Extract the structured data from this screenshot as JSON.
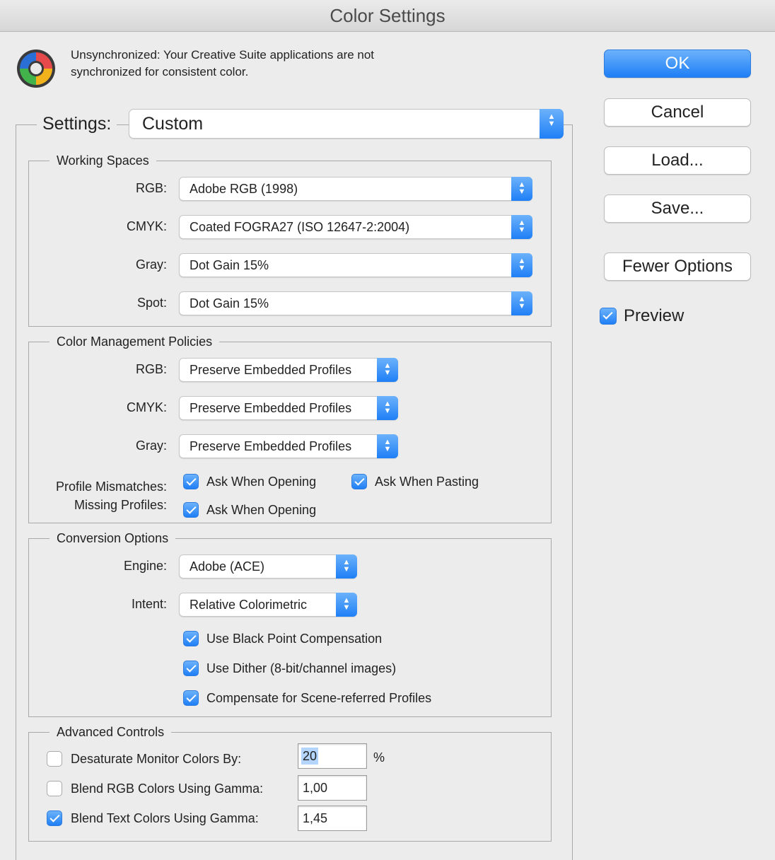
{
  "window": {
    "title": "Color Settings"
  },
  "sync_message": {
    "line1": "Unsynchronized: Your Creative Suite applications are not",
    "line2": "synchronized for consistent color."
  },
  "buttons": {
    "ok": "OK",
    "cancel": "Cancel",
    "load": "Load...",
    "save": "Save...",
    "fewer_options": "Fewer Options"
  },
  "preview": {
    "label": "Preview",
    "checked": true
  },
  "settings": {
    "label": "Settings:",
    "value": "Custom"
  },
  "working_spaces": {
    "title": "Working Spaces",
    "rgb": {
      "label": "RGB:",
      "value": "Adobe RGB (1998)"
    },
    "cmyk": {
      "label": "CMYK:",
      "value": "Coated FOGRA27 (ISO 12647-2:2004)"
    },
    "gray": {
      "label": "Gray:",
      "value": "Dot Gain 15%"
    },
    "spot": {
      "label": "Spot:",
      "value": "Dot Gain 15%"
    }
  },
  "policies": {
    "title": "Color Management Policies",
    "rgb": {
      "label": "RGB:",
      "value": "Preserve Embedded Profiles"
    },
    "cmyk": {
      "label": "CMYK:",
      "value": "Preserve Embedded Profiles"
    },
    "gray": {
      "label": "Gray:",
      "value": "Preserve Embedded Profiles"
    },
    "profile_mismatches": {
      "label": "Profile Mismatches:",
      "ask_opening": "Ask When Opening",
      "ask_pasting": "Ask When Pasting"
    },
    "missing_profiles": {
      "label": "Missing Profiles:",
      "ask_opening": "Ask When Opening"
    }
  },
  "conversion": {
    "title": "Conversion Options",
    "engine": {
      "label": "Engine:",
      "value": "Adobe (ACE)"
    },
    "intent": {
      "label": "Intent:",
      "value": "Relative Colorimetric"
    },
    "black_point": "Use Black Point Compensation",
    "dither": "Use Dither (8-bit/channel images)",
    "scene_referred": "Compensate for Scene-referred Profiles"
  },
  "advanced": {
    "title": "Advanced Controls",
    "desaturate": {
      "label": "Desaturate Monitor Colors By:",
      "value": "20",
      "unit": "%",
      "checked": false
    },
    "blend_rgb": {
      "label": "Blend RGB Colors Using Gamma:",
      "value": "1,00",
      "checked": false
    },
    "blend_text": {
      "label": "Blend Text Colors Using Gamma:",
      "value": "1,45",
      "checked": true
    }
  },
  "colors": {
    "accent": "#1f7ff6",
    "selection": "#b4d5fe"
  },
  "icons": {
    "logo": "color-wheel-icon",
    "stepper": "up-down-chevron-icon",
    "check": "checkmark-icon"
  }
}
